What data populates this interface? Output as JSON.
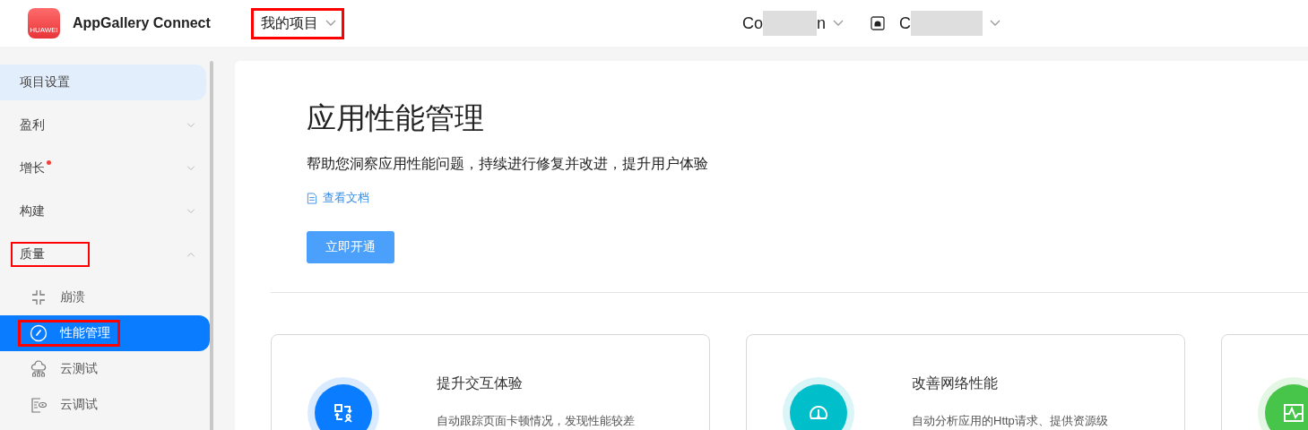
{
  "header": {
    "logo_text": "HUAWEI",
    "app_name": "AppGallery Connect",
    "project_menu": {
      "label": "我的项目",
      "highlighted": true
    },
    "account_menu": {
      "prefix": "Co",
      "suffix": "n"
    },
    "app_menu": {
      "prefix": "C"
    }
  },
  "sidebar": {
    "items": [
      {
        "label": "项目设置",
        "kind": "plain",
        "selected": true,
        "highlighted": false,
        "dot": false
      },
      {
        "label": "盈利",
        "kind": "group",
        "expanded": false,
        "highlighted": false,
        "dot": false,
        "selected": false
      },
      {
        "label": "增长",
        "kind": "group",
        "expanded": false,
        "highlighted": false,
        "dot": true,
        "selected": false
      },
      {
        "label": "构建",
        "kind": "group",
        "expanded": false,
        "highlighted": false,
        "dot": false,
        "selected": false
      },
      {
        "label": "质量",
        "kind": "group",
        "expanded": true,
        "highlighted": true,
        "dot": false,
        "selected": false,
        "children": [
          {
            "label": "崩溃",
            "selected": false,
            "highlighted": false
          },
          {
            "label": "性能管理",
            "selected": true,
            "highlighted": true
          },
          {
            "label": "云测试",
            "selected": false,
            "highlighted": false
          },
          {
            "label": "云调试",
            "selected": false,
            "highlighted": false
          }
        ]
      }
    ]
  },
  "hero": {
    "title": "应用性能管理",
    "subtitle": "帮助您洞察应用性能问题，持续进行修复并改进，提升用户体验",
    "doc_link": "查看文档",
    "button": "立即开通"
  },
  "cards": [
    {
      "title": "提升交互体验",
      "description": "自动跟踪页面卡顿情况，发现性能较差",
      "color": "#0a7cff"
    },
    {
      "title": "改善网络性能",
      "description": "自动分析应用的Http请求、提供资源级",
      "color": "#00bfca"
    },
    {
      "color": "#47c44a"
    }
  ]
}
